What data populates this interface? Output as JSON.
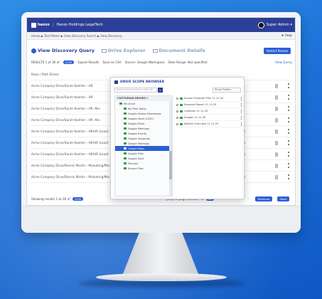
{
  "app": {
    "logo_text": "hanzo",
    "org": "Hanzo Holdings LegalTech",
    "user": "Super Admin ▾",
    "help": "Help"
  },
  "breadcrumb": "Hanzo ▶ Test Matter ▶ View Discovery Search ▶ View Discovery",
  "tabs": [
    "View Discovery Query",
    "Drive Explorer",
    "Document Details"
  ],
  "restart_label": "Restart Review",
  "results": {
    "label": "RESULTS 1 of 30 of",
    "count": "1540",
    "export": "Export Results",
    "save": "Save as CSV",
    "source": "Source: Google Workspace",
    "date_range": "Date Range: Not specified",
    "view_query": "View Query"
  },
  "list_header": "Rows / Path Drives",
  "rows": [
    {
      "text": "Acme Company Drive/Sarah Koehler › HR",
      "file": ""
    },
    {
      "text": "Acme Company Drive/Sarah Koehler › HR",
      "file": ""
    },
    {
      "text": "Acme Company Drive/Sarah Koehler › HR ‹file›",
      "file": ""
    },
    {
      "text": "Acme Company Drive/Sarah Koehler › HR ‹file›",
      "file": ""
    },
    {
      "text": "Acme Company Drive/Sarah Koehler › HR/HR (Lead)",
      "file": "managers.pdf)"
    },
    {
      "text": "Acme Company Drive/Sarah Koehler › HR/HR (Lead)",
      "file": "employees.pdf)"
    },
    {
      "text": "Acme Company Drive/Sarah Koehler › HR/HR (Lead)",
      "file": "pdf)"
    },
    {
      "text": "Acme Company Drive/Dennis Martin › Marketing/Marketing/Articles and PDFs",
      "file": ""
    },
    {
      "text": "Acme Company Drive/Dennis Martin › Marketing/Marketing/Articles and PDFs",
      "file": "ing.pdf)"
    }
  ],
  "bottom": {
    "summary": "Showing results 1 to 30 of",
    "count": "1540",
    "jump": "Jump to page number",
    "of": "of",
    "pages": "52",
    "prev": "Previous",
    "next": "Next"
  },
  "modal": {
    "title": "DRIVE SCOPE BROWSER",
    "search_placeholder": "Search drive items in this list",
    "dropdown": "Show Folders",
    "tree_header": "CUSTODIAN DRIVES ▾",
    "tree": [
      {
        "label": "My Drive",
        "level": 1,
        "selected": false
      },
      {
        "label": "My Files Today",
        "level": 2,
        "selected": false
      },
      {
        "label": "Google Videos Downloads",
        "level": 2,
        "selected": false
      },
      {
        "label": "Google Vault (2020)",
        "level": 2,
        "selected": false
      },
      {
        "label": "Google Drive",
        "level": 2,
        "selected": false
      },
      {
        "label": "Google Meetings",
        "level": 2,
        "selected": false
      },
      {
        "label": "Google Events",
        "level": 2,
        "selected": false
      },
      {
        "label": "Google Hangouts",
        "level": 2,
        "selected": false
      },
      {
        "label": "Google Meetings",
        "level": 2,
        "selected": false
      },
      {
        "label": "Google Maps",
        "level": 2,
        "selected": true
      },
      {
        "label": "Google Files",
        "level": 2,
        "selected": false
      },
      {
        "label": "Google Docs",
        "level": 2,
        "selected": false
      },
      {
        "label": "Pictures",
        "level": 2,
        "selected": false
      },
      {
        "label": "Shared Files",
        "level": 2,
        "selected": false
      }
    ],
    "files": [
      "Annual Financial Plan 11.11.20",
      "Expense Report 11.11.20",
      "Calendar 11.11.20",
      "Images 11.11.20",
      "Weekly Overview 11.11.20"
    ]
  }
}
